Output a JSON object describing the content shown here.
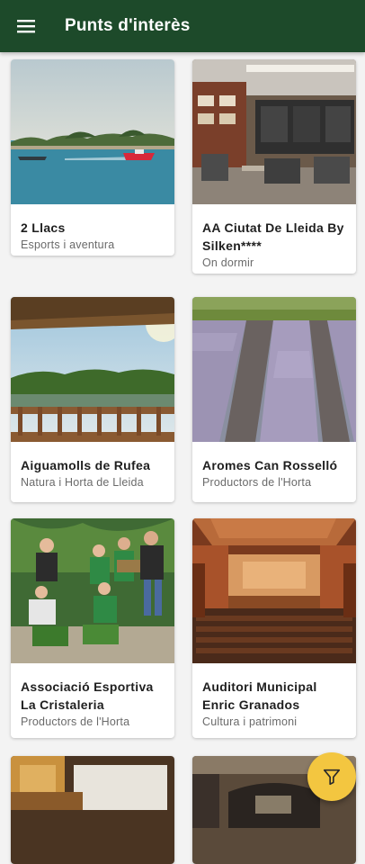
{
  "appbar": {
    "title": "Punts d'interès"
  },
  "cards": [
    {
      "name": "2 Llacs",
      "category": "Esports i aventura"
    },
    {
      "name": "AA Ciutat De Lleida By Silken****",
      "category": "On dormir"
    },
    {
      "name": "Aiguamolls de Rufea",
      "category": "Natura i Horta de Lleida"
    },
    {
      "name": "Aromes Can Rosselló",
      "category": "Productors de l'Horta"
    },
    {
      "name": "Associació Esportiva La Cristaleria",
      "category": "Productors de l'Horta"
    },
    {
      "name": "Auditori Municipal Enric Granados",
      "category": "Cultura i patrimoni"
    }
  ],
  "colors": {
    "appbar": "#1d4a2a",
    "fab": "#f3c640"
  },
  "icons": {
    "menu": "menu-icon",
    "filter": "filter-icon"
  }
}
